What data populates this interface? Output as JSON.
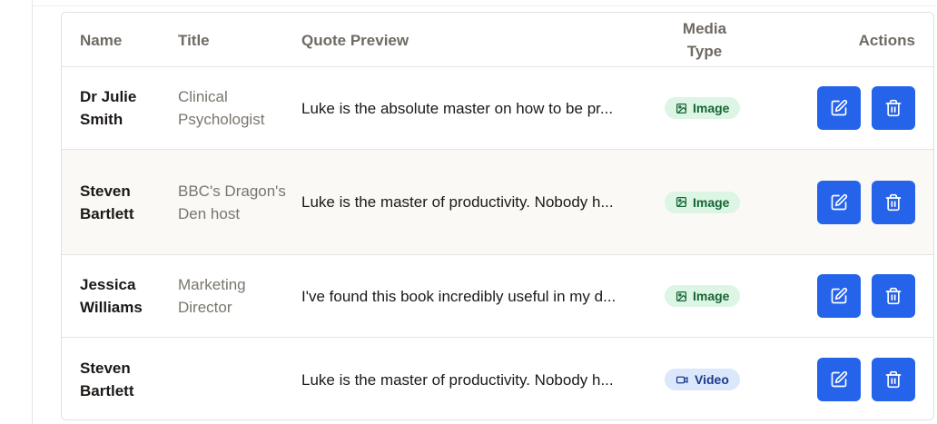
{
  "table": {
    "headers": {
      "name": "Name",
      "title": "Title",
      "quote": "Quote Preview",
      "media_line1": "Media",
      "media_line2": "Type",
      "actions": "Actions"
    },
    "rows": [
      {
        "name": "Dr Julie Smith",
        "title": "Clinical Psychologist",
        "quote": "Luke is the absolute master on how to be pr...",
        "media_type": "Image",
        "media_icon": "image-icon"
      },
      {
        "name": "Steven Bartlett",
        "title": "BBC's Dragon's Den host",
        "quote": "Luke is the master of productivity. Nobody h...",
        "media_type": "Image",
        "media_icon": "image-icon"
      },
      {
        "name": "Jessica Williams",
        "title": "Marketing Director",
        "quote": "I've found this book incredibly useful in my d...",
        "media_type": "Image",
        "media_icon": "image-icon"
      },
      {
        "name": "Steven Bartlett",
        "title": "",
        "quote": "Luke is the master of productivity. Nobody h...",
        "media_type": "Video",
        "media_icon": "video-icon"
      }
    ],
    "action_icons": [
      "edit-icon",
      "trash-icon"
    ]
  },
  "colors": {
    "primary_button": "#2563eb",
    "image_badge_bg": "#dcf5e4",
    "image_badge_text": "#166534",
    "video_badge_bg": "#dbe7fb",
    "video_badge_text": "#1e3a8a",
    "alt_row_bg": "#faf9f6"
  }
}
